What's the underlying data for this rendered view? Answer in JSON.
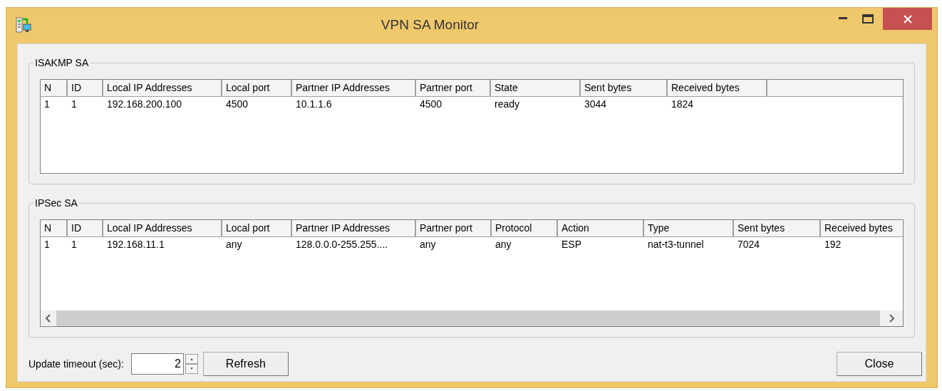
{
  "window": {
    "title": "VPN SA Monitor"
  },
  "groups": [
    {
      "title": "ISAKMP SA",
      "columns": [
        "N",
        "ID",
        "Local IP Addresses",
        "Local port",
        "Partner IP Addresses",
        "Partner port",
        "State",
        "Sent bytes",
        "Received bytes"
      ],
      "rows": [
        [
          "1",
          "1",
          "192.168.200.100",
          "4500",
          "10.1.1.6",
          "4500",
          "ready",
          "3044",
          "1824"
        ]
      ]
    },
    {
      "title": "IPSec SA",
      "columns": [
        "N",
        "ID",
        "Local IP Addresses",
        "Local port",
        "Partner IP Addresses",
        "Partner port",
        "Protocol",
        "Action",
        "Type",
        "Sent bytes",
        "Received bytes"
      ],
      "rows": [
        [
          "1",
          "1",
          "192.168.11.1",
          "any",
          "128.0.0.0-255.255....",
          "any",
          "any",
          "ESP",
          "nat-t3-tunnel",
          "7024",
          "192"
        ]
      ]
    }
  ],
  "update_timeout": {
    "label": "Update timeout (sec):",
    "value": "2"
  },
  "buttons": {
    "refresh": "Refresh",
    "close": "Close"
  }
}
